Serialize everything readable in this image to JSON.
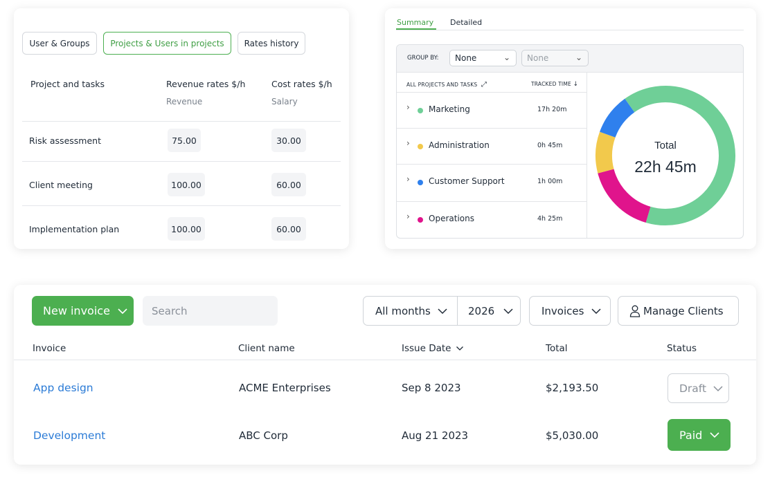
{
  "rates": {
    "tabs": [
      "User & Groups",
      "Projects & Users in projects",
      "Rates history"
    ],
    "active_tab_index": 1,
    "headers": {
      "task": "Project and tasks",
      "revenue": "Revenue rates $/h",
      "revenue_sub": "Revenue",
      "cost": "Cost rates $/h",
      "cost_sub": "Salary"
    },
    "rows": [
      {
        "task": "Risk assessment",
        "revenue": "75.00",
        "cost": "30.00"
      },
      {
        "task": "Client meeting",
        "revenue": "100.00",
        "cost": "60.00"
      },
      {
        "task": "Implementation plan",
        "revenue": "100.00",
        "cost": "60.00"
      }
    ]
  },
  "summary": {
    "tabs": [
      "Summary",
      "Detailed"
    ],
    "active_tab_index": 0,
    "group_by_label": "GROUP BY:",
    "group_by_value": "None",
    "group_by_secondary": "None",
    "col_projects": "ALL PROJECTS AND TASKS",
    "col_time": "TRACKED TIME",
    "projects": [
      {
        "name": "Marketing",
        "time": "17h 20m",
        "color": "#6fcf97",
        "minutes": 1040
      },
      {
        "name": "Administration",
        "time": "0h 45m",
        "color": "#f2c94c",
        "minutes": 45
      },
      {
        "name": "Customer Support",
        "time": "1h 00m",
        "color": "#2f80ed",
        "minutes": 60
      },
      {
        "name": "Operations",
        "time": "4h 25m",
        "color": "#e0148c",
        "minutes": 265
      }
    ],
    "total_label": "Total",
    "total_value": "22h 45m"
  },
  "invoices": {
    "new_invoice_label": "New invoice",
    "search_placeholder": "Search",
    "months_filter": "All months",
    "year_filter": "2026",
    "type_filter": "Invoices",
    "manage_clients_label": "Manage Clients",
    "columns": {
      "invoice": "Invoice",
      "client": "Client name",
      "issue_date": "Issue Date",
      "total": "Total",
      "status": "Status"
    },
    "rows": [
      {
        "invoice": "App design",
        "client": "ACME Enterprises",
        "date": "Sep 8 2023",
        "total": "$2,193.50",
        "status": "Draft"
      },
      {
        "invoice": "Development",
        "client": "ABC Corp",
        "date": "Aug 21 2023",
        "total": "$5,030.00",
        "status": "Paid"
      }
    ]
  },
  "colors": {
    "accent_green": "#4caf50",
    "link_blue": "#2b7bd6"
  }
}
